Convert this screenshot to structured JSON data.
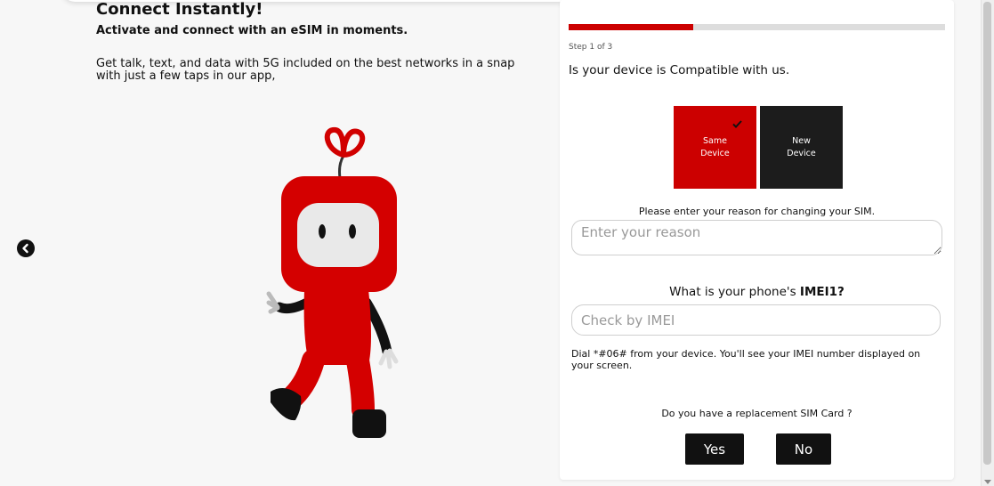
{
  "hero": {
    "title": "Connect Instantly!",
    "subtitle": "Activate and connect with an eSIM in moments.",
    "body": "Get talk, text, and data with 5G included on the best networks in a snap with just a few taps in our app,"
  },
  "progress": {
    "value": 0.33,
    "step_text": "Step 1 of 3"
  },
  "form": {
    "question": "Is your device is Compatible with us.",
    "device_options": [
      {
        "label_line1": "Same",
        "label_line2": "Device",
        "selected": true
      },
      {
        "label_line1": "New",
        "label_line2": "Device",
        "selected": false
      }
    ],
    "reason_label": "Please enter your reason for changing your SIM.",
    "reason_placeholder": "Enter your reason",
    "imei_label_prefix": "What is your phone's ",
    "imei_label_bold": "IMEI1?",
    "imei_placeholder": "Check by IMEI",
    "imei_hint": "Dial *#06# from your device. You'll see your IMEI number displayed on your screen.",
    "replacement_question": "Do you have a replacement SIM Card ?",
    "yes_label": "Yes",
    "no_label": "No"
  },
  "colors": {
    "accent": "#cc0000",
    "dark": "#1c1c1c"
  },
  "icons": {
    "back": "chevron-left-circle-icon",
    "check": "checkmark-icon"
  }
}
